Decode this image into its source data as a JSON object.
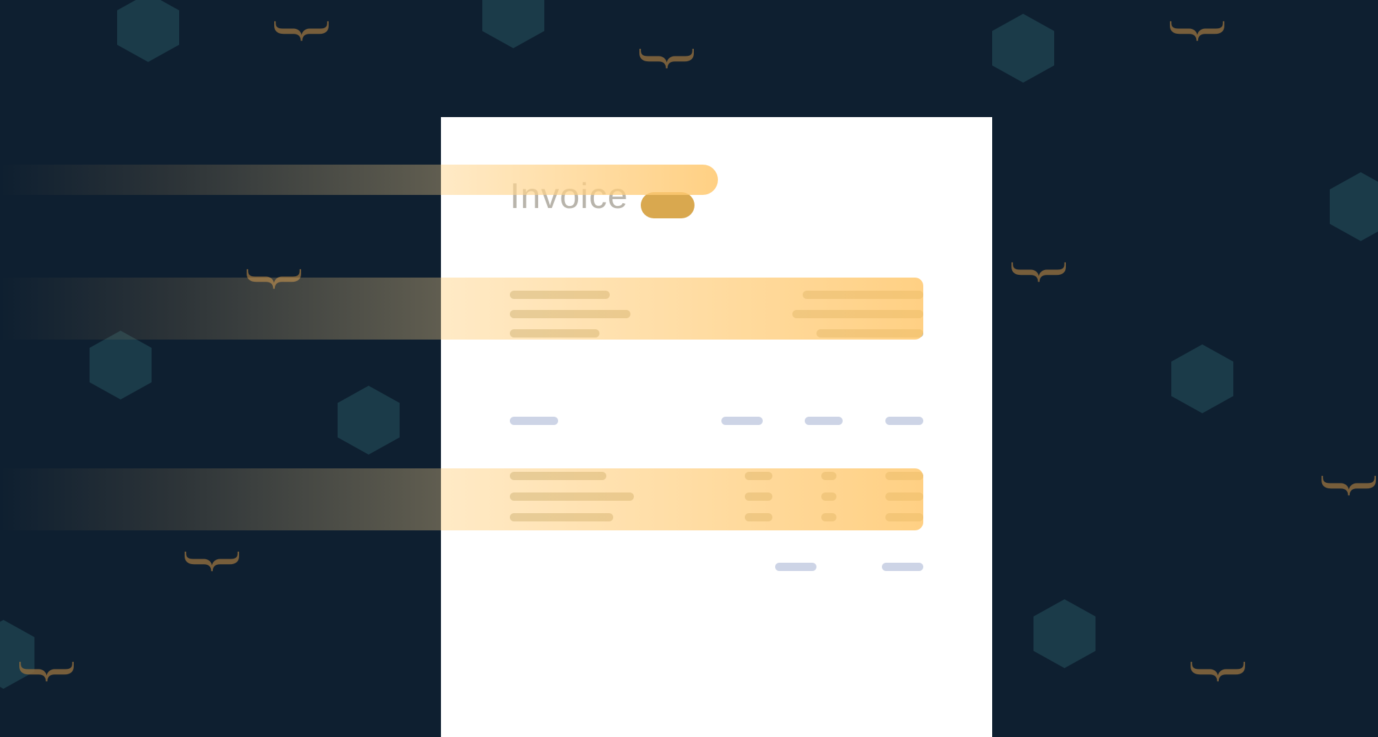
{
  "document": {
    "title": "Invoice"
  },
  "colors": {
    "background": "#0e1f30",
    "hexagon": "#254e5a",
    "brace": "#8a6a3e",
    "highlight": "#f5c678",
    "paper": "#ffffff",
    "titleText": "#b8b4ab",
    "placeholderDark": "#beb79b",
    "placeholderBlue": "#cdd4e6"
  }
}
